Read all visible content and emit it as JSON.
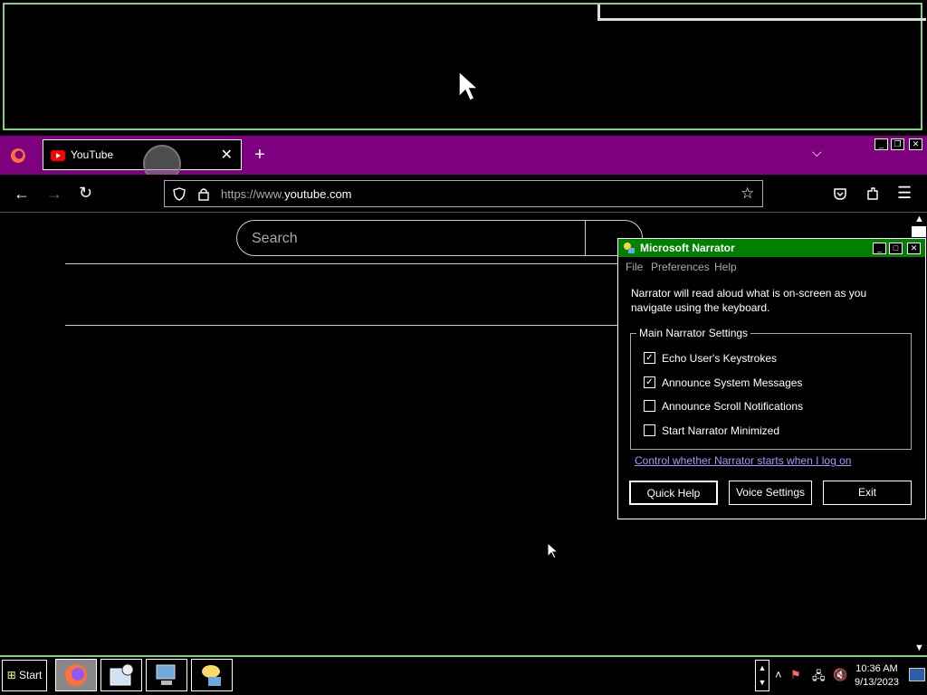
{
  "firefox": {
    "tab_title": "YouTube",
    "tab_close": "✕",
    "new_tab": "+",
    "tab_list": "⌵",
    "url_prefix": "https://www.",
    "url_domain": "youtube.com",
    "icons": [
      "firefox-logo-icon",
      "back-icon",
      "forward-icon",
      "reload-icon",
      "shield-icon",
      "lock-icon",
      "star-icon",
      "pocket-icon",
      "extensions-icon",
      "menu-icon"
    ]
  },
  "youtube": {
    "search_placeholder": "Search"
  },
  "narrator": {
    "title": "Microsoft Narrator",
    "menu": [
      "File",
      "Preferences",
      "Help"
    ],
    "description": "Narrator will read aloud what is on-screen as you navigate using the keyboard.",
    "group_title": "Main Narrator Settings",
    "options": [
      {
        "label": "Echo User's Keystrokes",
        "checked": true
      },
      {
        "label": "Announce System Messages",
        "checked": true
      },
      {
        "label": "Announce Scroll Notifications",
        "checked": false
      },
      {
        "label": "Start Narrator Minimized",
        "checked": false
      }
    ],
    "link": "Control whether Narrator starts when I log on",
    "buttons": [
      "Quick Help",
      "Voice Settings",
      "Exit"
    ]
  },
  "taskbar": {
    "start_label": "Start",
    "time": "10:36 AM",
    "date": "9/13/2023"
  },
  "colors": {
    "tabbar": "#7f007f",
    "narrator_title": "#008000",
    "accent_border": "#7fd17f",
    "link": "#9c9cff"
  }
}
